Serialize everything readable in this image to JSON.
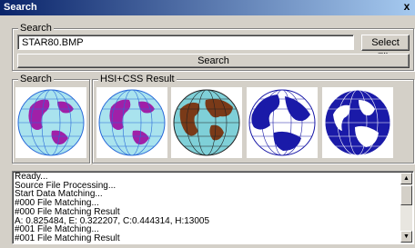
{
  "window": {
    "title": "Search",
    "close_glyph": "x"
  },
  "search_group": {
    "legend": "Search",
    "file_value": "STAR80.BMP",
    "select_file_label": "Select File",
    "search_label": "Search"
  },
  "query_group": {
    "legend": "Search"
  },
  "result_group": {
    "legend": "HSI+CSS Result"
  },
  "images": [
    {
      "name": "query-globe",
      "ocean": "#a9e3ee",
      "land": "#a020a8",
      "grid": "#2a6ad8",
      "style": "globe-purple"
    },
    {
      "name": "result-globe-1",
      "ocean": "#a9e3ee",
      "land": "#a020a8",
      "grid": "#2a6ad8",
      "style": "globe-purple"
    },
    {
      "name": "result-globe-2",
      "ocean": "#7fd0d8",
      "land": "#7a3a18",
      "grid": "#222222",
      "style": "globe-brown"
    },
    {
      "name": "result-globe-3",
      "ocean": "#ffffff",
      "land": "#1a1aa8",
      "grid": "#1a1aa8",
      "style": "globe-blue"
    },
    {
      "name": "result-globe-4",
      "ocean": "#1a1aa8",
      "land": "#ffffff",
      "grid": "#ffffff",
      "style": "globe-blue-inv"
    }
  ],
  "log": {
    "lines": [
      "Ready...",
      "Source File Processing...",
      "Start Data Matching...",
      "#000 File Matching...",
      "#000 File Matching Result",
      "A: 0.825484, E: 0.322207, C:0.444314, H:13005",
      "#001 File Matching...",
      "#001 File Matching Result"
    ]
  }
}
